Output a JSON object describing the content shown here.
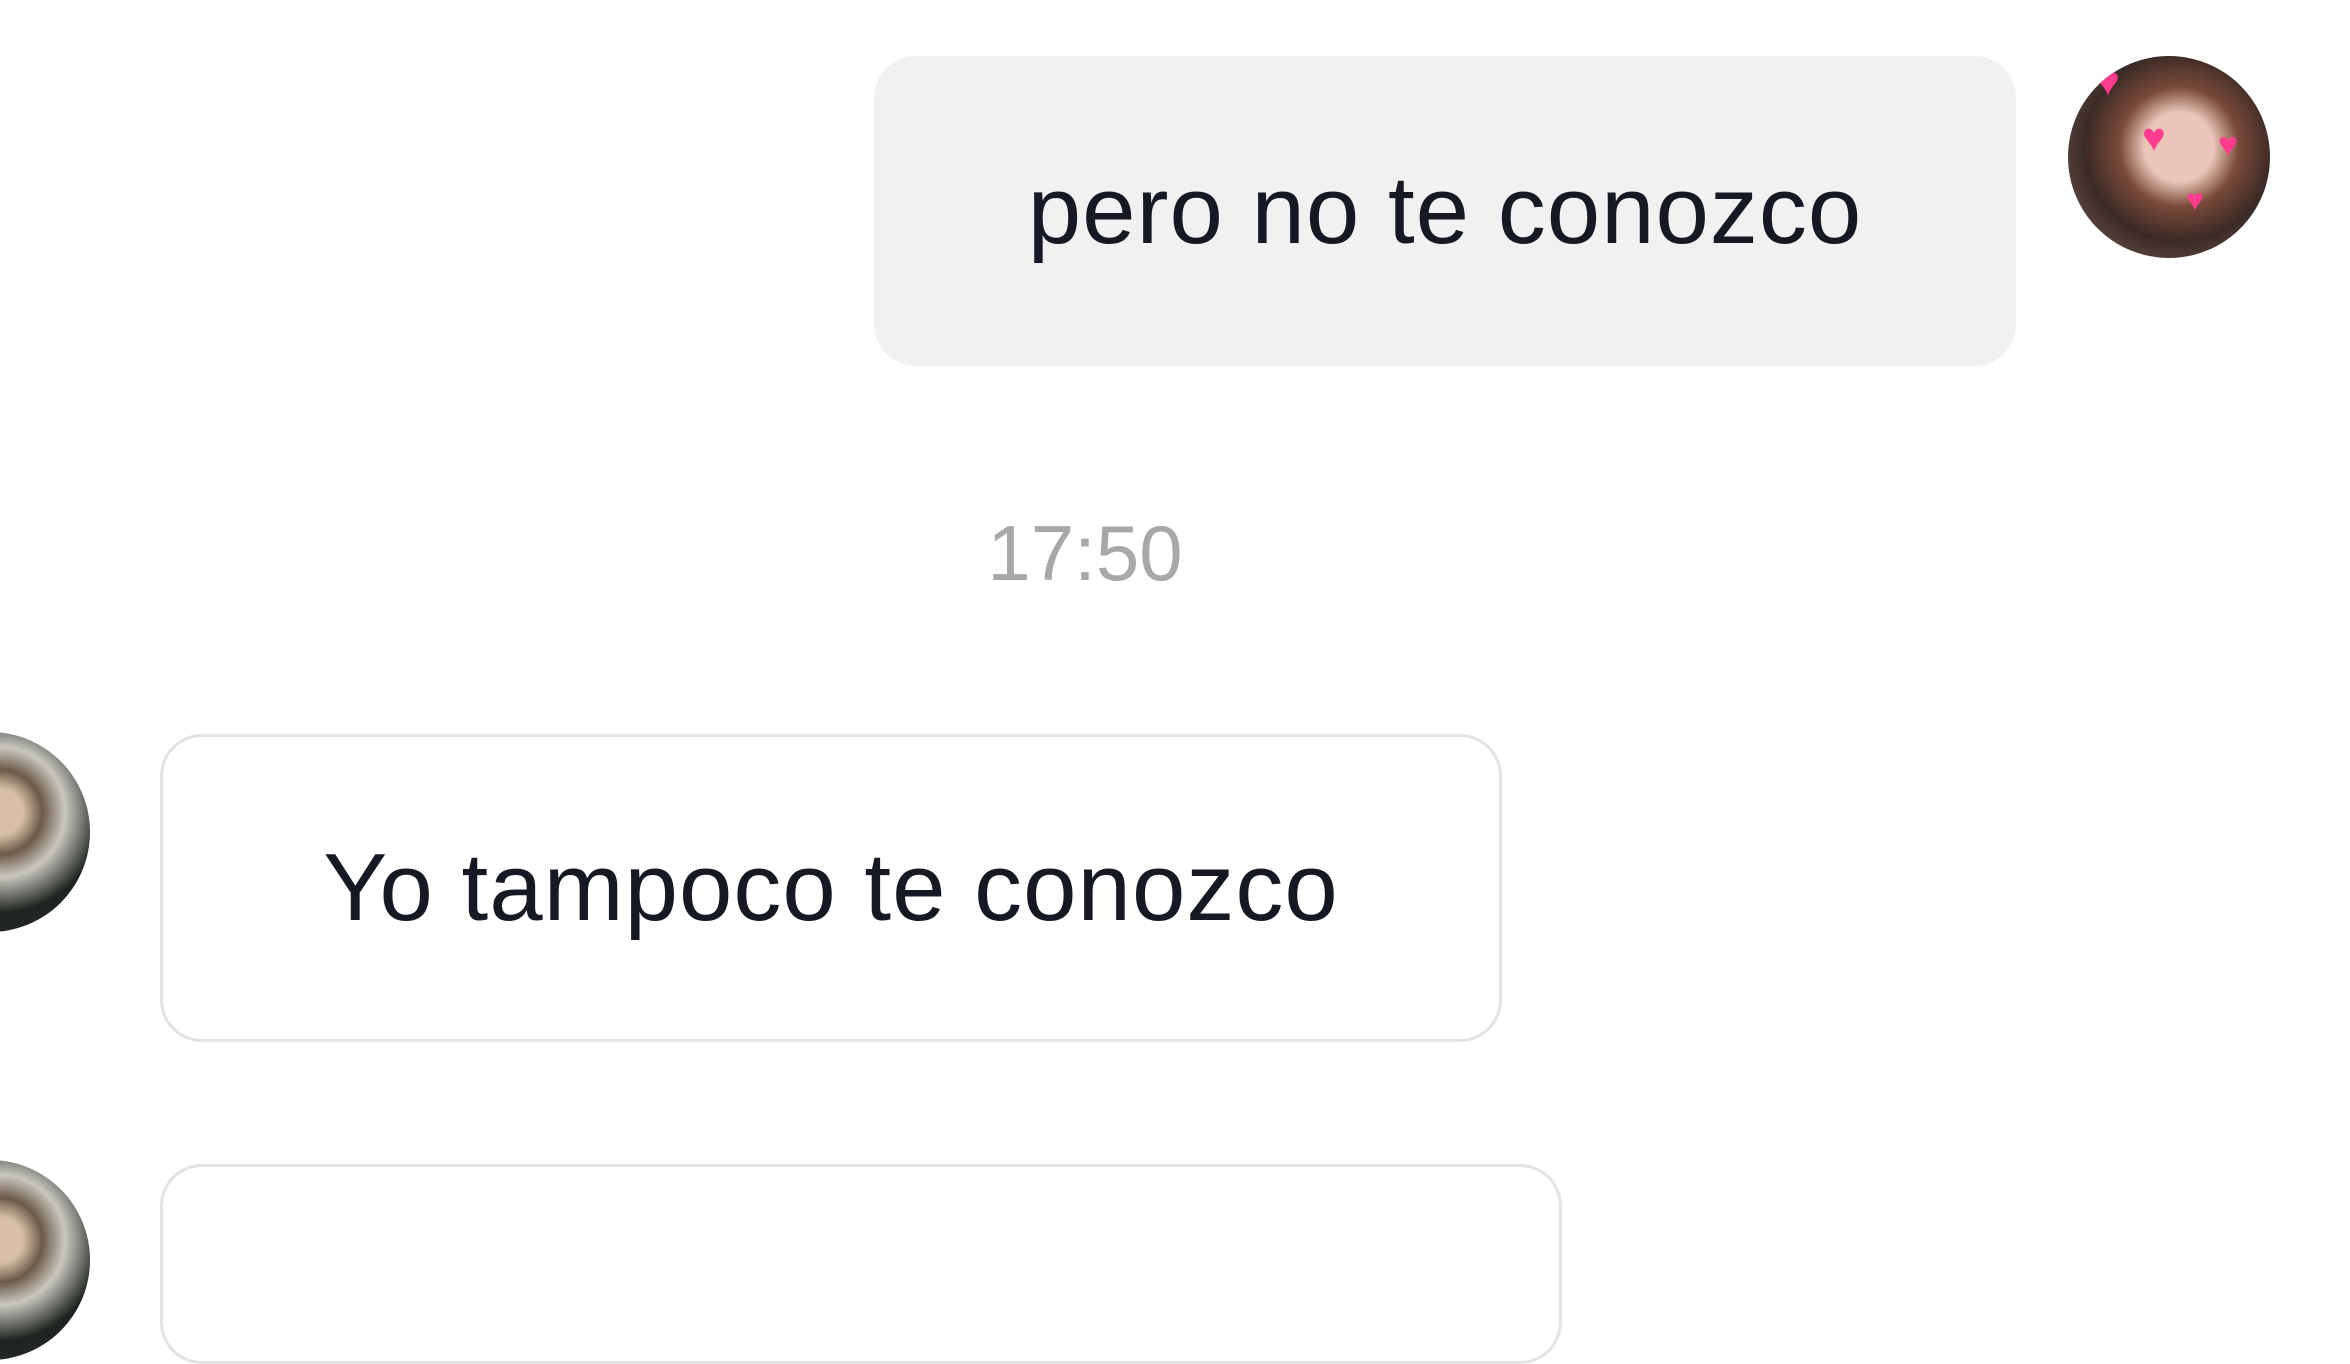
{
  "messages": [
    {
      "direction": "outgoing",
      "text": "pero no te conozco"
    },
    {
      "direction": "incoming",
      "text": "Yo tampoco te conozco"
    },
    {
      "direction": "incoming",
      "text": ""
    }
  ],
  "timestamp": "17:50",
  "colors": {
    "outgoing_bubble": "#f1f1f2",
    "incoming_border": "#e3e3e4",
    "timestamp": "#a8a8ab",
    "text": "#161823",
    "heart": "#ff3c8e"
  },
  "icons": {
    "heart": "♥"
  }
}
